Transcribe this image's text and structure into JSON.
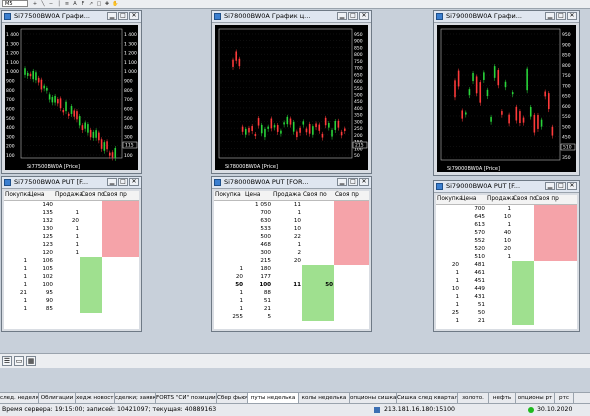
{
  "toolbar": {
    "instrument": "M5"
  },
  "windows": [
    {
      "chart_title": "Si77500BW0A Графи...",
      "chart_legend": "Si77500BW0A [Price]",
      "table_title": "Si77500BW0A PUT [F...",
      "headers": [
        "Покупка",
        "Цена",
        "Продажа",
        "Своя по",
        "Своя пр"
      ],
      "sell_rows": [
        [
          "",
          "140",
          "",
          ""
        ],
        [
          "",
          "135",
          "1",
          ""
        ],
        [
          "",
          "132",
          "20",
          ""
        ],
        [
          "",
          "130",
          "1",
          ""
        ],
        [
          "",
          "125",
          "1",
          ""
        ],
        [
          "",
          "123",
          "1",
          ""
        ],
        [
          "",
          "120",
          "1",
          ""
        ]
      ],
      "buy_rows": [
        [
          "1",
          "106"
        ],
        [
          "1",
          "105"
        ],
        [
          "1",
          "102"
        ],
        [
          "1",
          "100"
        ],
        [
          "21",
          "95"
        ],
        [
          "1",
          "90"
        ],
        [
          "1",
          "85"
        ]
      ],
      "bold_row": -1
    },
    {
      "chart_title": "Si78000BW0A График ц...",
      "chart_legend": "Si78000BW0A [Price]",
      "table_title": "Si78000BW0A PUT [FOR...",
      "headers": [
        "Покупка",
        "Цена",
        "Продажа",
        "Своя по",
        "Своя пр"
      ],
      "sell_rows": [
        [
          "",
          "1 050",
          "11",
          ""
        ],
        [
          "",
          "700",
          "1",
          ""
        ],
        [
          "",
          "630",
          "10",
          ""
        ],
        [
          "",
          "533",
          "10",
          ""
        ],
        [
          "",
          "500",
          "22",
          ""
        ],
        [
          "",
          "468",
          "1",
          ""
        ],
        [
          "",
          "300",
          "2",
          ""
        ],
        [
          "",
          "215",
          "20",
          ""
        ]
      ],
      "buy_rows": [
        [
          "1",
          "180"
        ],
        [
          "20",
          "177"
        ],
        [
          "50",
          "100"
        ],
        [
          "1",
          "88"
        ],
        [
          "1",
          "51"
        ],
        [
          "1",
          "21"
        ],
        [
          "255",
          "5"
        ]
      ],
      "buy_extra": {
        "row": 2,
        "sell": "11",
        "own": "50"
      },
      "bold_row": 2
    },
    {
      "chart_title": "Si79000BW0A Графи...",
      "chart_legend": "Si79000BW0A [Price]",
      "table_title": "Si79000BW0A PUT [F...",
      "headers": [
        "Покупка",
        "Цена",
        "Продажа",
        "Своя по",
        "Своя пр"
      ],
      "sell_rows": [
        [
          "",
          "700",
          "1",
          ""
        ],
        [
          "",
          "645",
          "10",
          ""
        ],
        [
          "",
          "613",
          "1",
          ""
        ],
        [
          "",
          "570",
          "40",
          ""
        ],
        [
          "",
          "552",
          "10",
          ""
        ],
        [
          "",
          "520",
          "20",
          ""
        ],
        [
          "",
          "510",
          "1",
          ""
        ]
      ],
      "buy_rows": [
        [
          "20",
          "481"
        ],
        [
          "1",
          "461"
        ],
        [
          "1",
          "451"
        ],
        [
          "10",
          "449"
        ],
        [
          "1",
          "431"
        ],
        [
          "1",
          "51"
        ],
        [
          "25",
          "50"
        ],
        [
          "1",
          "21"
        ]
      ],
      "bold_row": -1
    }
  ],
  "charts": [
    {
      "ylabels": [
        "1 400",
        "1 300",
        "1 200",
        "1 100",
        "1 000",
        "900",
        "800",
        "700",
        "600",
        "500",
        "400",
        "300",
        "200",
        "100"
      ],
      "last_price": "115"
    },
    {
      "ylabels": [
        "950",
        "900",
        "850",
        "800",
        "750",
        "700",
        "650",
        "600",
        "550",
        "500",
        "450",
        "400",
        "350",
        "300",
        "250",
        "200",
        "150",
        "100",
        "50"
      ],
      "last_price": "215"
    },
    {
      "ylabels": [
        "950",
        "900",
        "850",
        "800",
        "750",
        "700",
        "650",
        "600",
        "550",
        "500",
        "450",
        "400",
        "350"
      ],
      "last_price": "510"
    }
  ],
  "tabs": [
    "след. неделя",
    "Облигации",
    "хедж новости",
    "сделки; заявки",
    "FORTS \"СИ\" позиции.",
    "Сбер фьюч",
    "путы неделька",
    "колы неделька",
    "опционы сишка",
    "Сишка след квартал",
    "золото.",
    "нефть",
    "опционы рт",
    "ртс"
  ],
  "active_tab": 6,
  "status": {
    "server_time": "Время сервера: 19:15:00; записей: 10421097; текущая: 40889163",
    "connection": "213.181.16.180:15100",
    "date": "30.10.2020"
  },
  "colors": {
    "sell_bg": "#f5a3a9",
    "buy_bg": "#9fe08f",
    "chart_bg": "#000000",
    "candle_up": "#29d43a",
    "candle_down": "#ff3a3a",
    "status_ok": "#1fb91f"
  }
}
